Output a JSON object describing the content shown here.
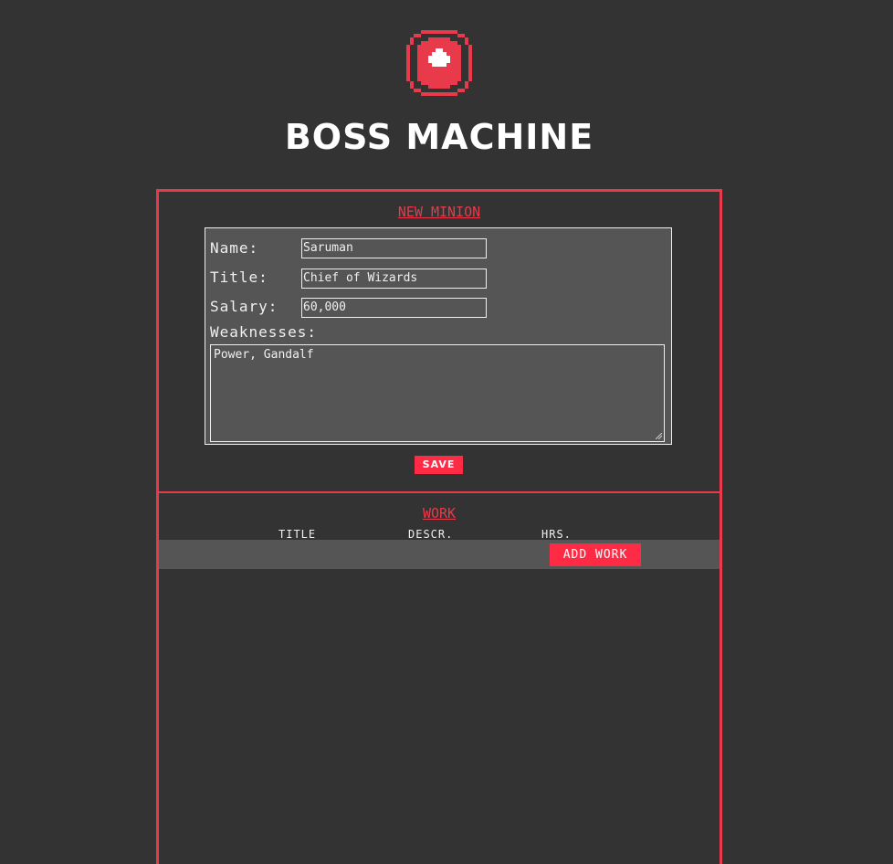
{
  "app": {
    "title": "BOSS MACHINE",
    "logo_icon": "pixel-target-icon",
    "accent_color": "#ff2a44"
  },
  "minion_section": {
    "heading": "NEW MINION",
    "fields": {
      "name_label": "Name:",
      "name_value": "Saruman",
      "title_label": "Title:",
      "title_value": "Chief of Wizards",
      "salary_label": "Salary:",
      "salary_value": "60,000",
      "weaknesses_label": "Weaknesses:",
      "weaknesses_value": "Power, Gandalf"
    },
    "save_label": "SAVE"
  },
  "work_section": {
    "heading": "WORK",
    "columns": [
      "TITLE",
      "DESCR.",
      "HRS."
    ],
    "add_label": "ADD WORK"
  }
}
